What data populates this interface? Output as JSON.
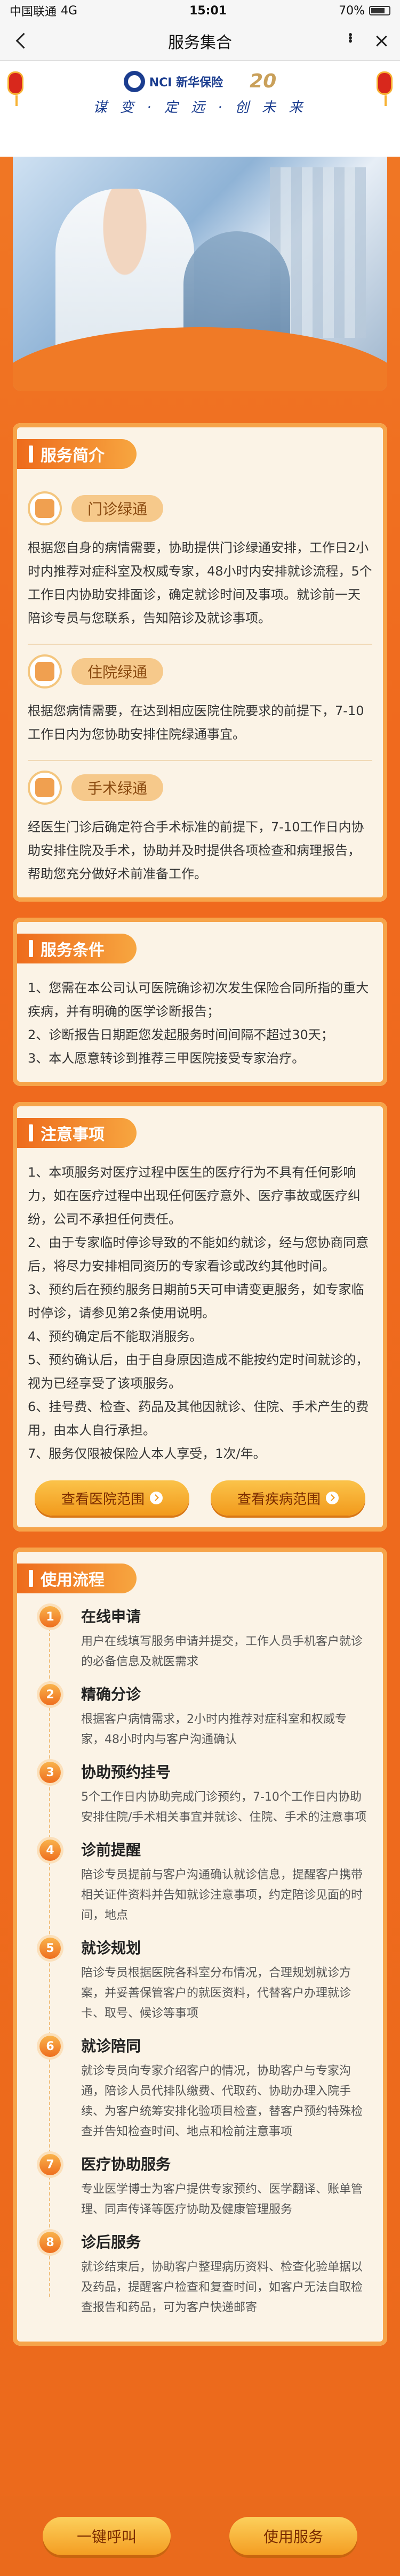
{
  "status_bar": {
    "carrier": "中国联通",
    "network": "4G",
    "time": "15:01",
    "battery": "70%"
  },
  "nav": {
    "title": "服务集合"
  },
  "header": {
    "brand": "NCI 新华保险",
    "anniversary": "20",
    "slogan": "谋 变 · 定 远 · 创 未 来"
  },
  "intro": {
    "title": "服务简介",
    "services": [
      {
        "name": "门诊绿通",
        "icon": "doctor-icon",
        "desc": "根据您自身的病情需要，协助提供门诊绿通安排，工作日2小时内推荐对症科室及权威专家，48小时内安排就诊流程，5个工作日内协助安排面诊，确定就诊时间及事项。就诊前一天陪诊专员与您联系，告知陪诊及就诊事项。"
      },
      {
        "name": "住院绿通",
        "icon": "hospital-icon",
        "desc": "根据您病情需要，在达到相应医院住院要求的前提下，7-10工作日内为您协助安排住院绿通事宜。"
      },
      {
        "name": "手术绿通",
        "icon": "surgery-icon",
        "desc": "经医生门诊后确定符合手术标准的前提下，7-10工作日内协助安排住院及手术，协助并及时提供各项检查和病理报告，帮助您充分做好术前准备工作。"
      }
    ]
  },
  "conditions": {
    "title": "服务条件",
    "text": "1、您需在本公司认可医院确诊初次发生保险合同所指的重大疾病，并有明确的医学诊断报告；\n2、诊断报告日期距您发起服务时间间隔不超过30天；\n3、本人愿意转诊到推荐三甲医院接受专家治疗。"
  },
  "notes": {
    "title": "注意事项",
    "text": "1、本项服务对医疗过程中医生的医疗行为不具有任何影响力，如在医疗过程中出现任何医疗意外、医疗事故或医疗纠纷，公司不承担任何责任。\n2、由于专家临时停诊导致的不能如约就诊，经与您协商同意后，将尽力安排相同资历的专家看诊或改约其他时间。\n3、预约后在预约服务日期前5天可申请变更服务，如专家临时停诊，请参见第2条使用说明。\n4、预约确定后不能取消服务。\n5、预约确认后，由于自身原因造成不能按约定时间就诊的，视为已经享受了该项服务。\n6、挂号费、检查、药品及其他因就诊、住院、手术产生的费用，由本人自行承担。\n7、服务仅限被保险人本人享受，1次/年。",
    "buttons": [
      "查看医院范围",
      "查看疾病范围"
    ]
  },
  "flow": {
    "title": "使用流程",
    "steps": [
      {
        "num": "1",
        "title": "在线申请",
        "desc": "用户在线填写服务申请并提交，工作人员手机客户就诊的必备信息及就医需求"
      },
      {
        "num": "2",
        "title": "精确分诊",
        "desc": "根据客户病情需求，2小时内推荐对症科室和权威专家，48小时内与客户沟通确认"
      },
      {
        "num": "3",
        "title": "协助预约挂号",
        "desc": "5个工作日内协助完成门诊预约，7-10个工作日内协助安排住院/手术相关事宜并就诊、住院、手术的注意事项"
      },
      {
        "num": "4",
        "title": "诊前提醒",
        "desc": "陪诊专员提前与客户沟通确认就诊信息，提醒客户携带相关证件资料并告知就诊注意事项，约定陪诊见面的时间，地点"
      },
      {
        "num": "5",
        "title": "就诊规划",
        "desc": "陪诊专员根据医院各科室分布情况，合理规划就诊方案，并妥善保管客户的就医资料，代替客户办理就诊卡、取号、候诊等事项"
      },
      {
        "num": "6",
        "title": "就诊陪同",
        "desc": "就诊专员向专家介绍客户的情况，协助客户与专家沟通，陪诊人员代排队缴费、代取药、协助办理入院手续、为客户统筹安排化验项目检查，替客户预约特殊检查并告知检查时间、地点和检前注意事项"
      },
      {
        "num": "7",
        "title": "医疗协助服务",
        "desc": "专业医学博士为客户提供专家预约、医学翻译、账单管理、同声传译等医疗协助及健康管理服务"
      },
      {
        "num": "8",
        "title": "诊后服务",
        "desc": "就诊结束后，协助客户整理病历资料、检查化验单据以及药品，提醒客户检查和复查时间，如客户无法自取检查报告和药品，可为客户快递邮寄"
      }
    ]
  },
  "bottom": {
    "call_label": "一键呼叫",
    "use_label": "使用服务"
  }
}
